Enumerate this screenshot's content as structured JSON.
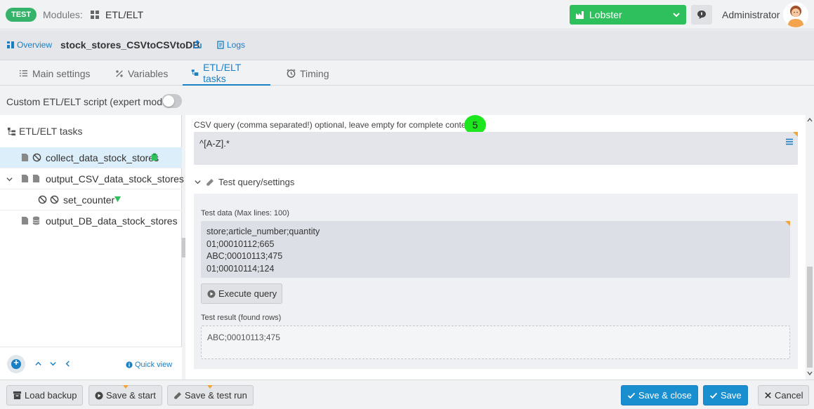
{
  "topbar": {
    "env_badge": "TEST",
    "modules_label": "Modules:",
    "modules_value": "ETL/ELT",
    "profile_select": "Lobster",
    "user_name": "Administrator"
  },
  "header": {
    "overview_label": "Overview",
    "job_title": "stock_stores_CSVtoCSVtoDB",
    "logs_label": "Logs"
  },
  "tabs": [
    {
      "label": "Main settings",
      "active": false
    },
    {
      "label": "Variables",
      "active": false
    },
    {
      "label": "ETL/ELT tasks",
      "active": true
    },
    {
      "label": "Timing",
      "active": false
    }
  ],
  "custom_script": {
    "label": "Custom ETL/ELT script (expert mode)",
    "enabled": false
  },
  "tree": {
    "header": "ETL/ELT tasks",
    "items": [
      {
        "label": "collect_data_stock_stores"
      },
      {
        "label": "output_CSV_data_stock_stores"
      },
      {
        "label": "set_counter"
      },
      {
        "label": "output_DB_data_stock_stores"
      }
    ],
    "quick_view_label": "Quick view"
  },
  "detail": {
    "csv_query_label": "CSV query (comma separated!) optional, leave empty for complete content",
    "step_badge": "5",
    "csv_query_value": "^[A-Z].*",
    "test_section_label": "Test query/settings",
    "test_data_label": "Test data (Max lines: 100)",
    "test_data_lines": [
      "store;article_number;quantity",
      "01;00010112;665",
      "ABC;00010113;475",
      "01;00010114;124"
    ],
    "execute_button": "Execute query",
    "test_result_label": "Test result (found rows)",
    "test_result_value": "ABC;00010113;475"
  },
  "footer": {
    "load_backup": "Load backup",
    "save_start": "Save & start",
    "save_test_run": "Save & test run",
    "save_close": "Save & close",
    "save": "Save",
    "cancel": "Cancel"
  },
  "colors": {
    "accent": "#1a7fc3",
    "env_green": "#2ec05c",
    "badge_green": "#1ee61e",
    "selected_row": "#dceef9"
  }
}
